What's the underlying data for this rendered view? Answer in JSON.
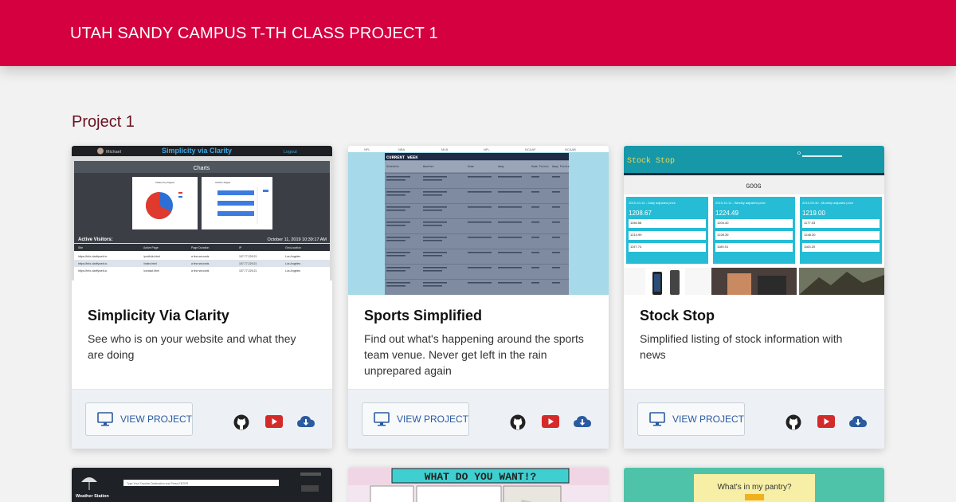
{
  "header": {
    "title": "UTAH SANDY CAMPUS T-TH CLASS PROJECT 1"
  },
  "section": {
    "title": "Project 1"
  },
  "cards": [
    {
      "name": "Simplicity Via Clarity",
      "desc": "See who is on your website and what they are doing",
      "btn": "VIEW PROJECT",
      "thumb": {
        "brand": "Simplicity via Clarity",
        "user": "Michael",
        "logout": "Logout",
        "panel": "Charts",
        "chart1": "Visitors by Region",
        "chart2": "Visitors Pages",
        "visitors": "Active Visitors:",
        "date": "October 11, 2019 10:39:17 AM",
        "cols": [
          "Site",
          "Active Page",
          "Page Duration",
          "IP",
          "GeoLocation"
        ],
        "rows": [
          [
            "https://info.clarifyweb.io",
            "/portfolio.html",
            "a few seconds",
            "107.77.229.21",
            "Los Angeles"
          ],
          [
            "https://info.clarifyweb.io",
            "/index.html",
            "a few seconds",
            "107.77.229.21",
            "Los Angeles"
          ],
          [
            "https://info.clarifyweb.io",
            "/contact.html",
            "a few seconds",
            "107.77.229.21",
            "Los Angeles"
          ]
        ]
      }
    },
    {
      "name": "Sports Simplified",
      "desc": "Find out what's happening around the sports team venue. Never get left in the rain unprepared again",
      "btn": "VIEW PROJECT",
      "thumb": {
        "nav": [
          "NFL",
          "NBA",
          "MLB",
          "NFL",
          "NCAAF",
          "NCAAB"
        ],
        "banner": "CURRENT WEEK",
        "cols": [
          "Schedule",
          "Weather",
          "Home",
          "Away",
          "Home Points",
          "Away Points"
        ]
      }
    },
    {
      "name": "Stock Stop",
      "desc": "Simplified listing of stock information with news",
      "btn": "VIEW PROJECT",
      "thumb": {
        "brand": "Stock Stop",
        "ticker": "GOOG",
        "boxes": [
          {
            "head": "2019-10-10 - Daily adjusted price",
            "price": "1208.67",
            "rows": [
              "1198.58",
              "1214.99",
              "1197.74"
            ]
          },
          {
            "head": "2019-10-11 - Weekly adjusted price",
            "price": "1224.49",
            "rows": [
              "1204.40",
              "1228.39",
              "1189.01"
            ]
          },
          {
            "head": "2019-09-30 - Monthly adjusted price",
            "price": "1219.00",
            "rows": [
              "1177.03",
              "1248.30",
              "1163.20"
            ]
          }
        ]
      }
    }
  ],
  "second_row": [
    {
      "label": "Weather Station",
      "search": "Type Your Favorite Destination and Press ENTER"
    },
    {
      "label": "WHAT DO YOU WANT!?"
    },
    {
      "label": "What's in my pantry?"
    }
  ],
  "colors": {
    "accent": "#d40040",
    "button_text": "#2a5aa0",
    "github": "#222222",
    "youtube": "#d42a2a",
    "download": "#2a5aa0"
  },
  "icons": [
    "monitor-icon",
    "github-icon",
    "youtube-icon",
    "cloud-download-icon"
  ]
}
